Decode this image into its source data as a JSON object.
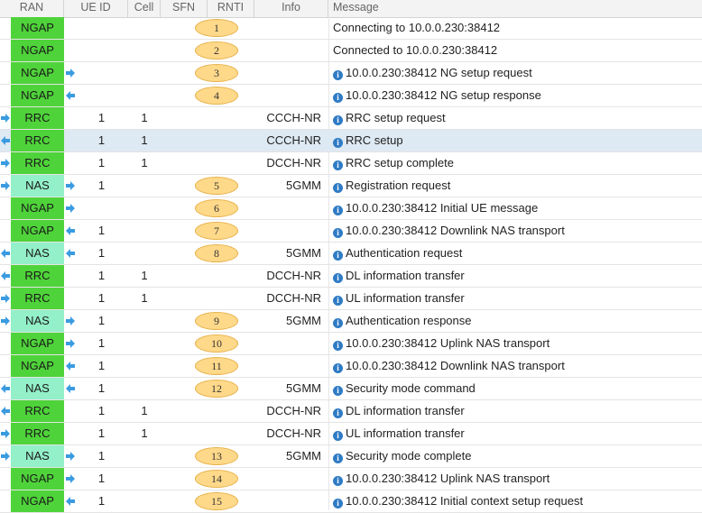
{
  "columns": [
    "RAN",
    "UE ID",
    "Cell",
    "SFN",
    "RNTI",
    "Info",
    "Message"
  ],
  "icons": {
    "right": "arrow-right-icon",
    "left": "arrow-left-icon",
    "info": "info-icon"
  },
  "colors": {
    "ngap": "#4fd33a",
    "nas": "#93f0c8",
    "badge": "#ffd98a",
    "arrow": "#3a9be0",
    "selected_row": "#dde9f3"
  },
  "rows": [
    {
      "ran": "NGAP",
      "ue": "",
      "cell": "",
      "badge": "1",
      "info": "",
      "message": "Connecting to 10.0.0.230:38412",
      "info_icon": false,
      "right_arrow": false,
      "left_arrow": false
    },
    {
      "ran": "NGAP",
      "ue": "",
      "cell": "",
      "badge": "2",
      "info": "",
      "message": "Connected to 10.0.0.230:38412",
      "info_icon": false,
      "right_arrow": false,
      "left_arrow": false
    },
    {
      "ran": "NGAP",
      "ue": "",
      "cell": "",
      "badge": "3",
      "info": "",
      "message": "10.0.0.230:38412 NG setup request",
      "info_icon": true,
      "right_arrow": true,
      "left_arrow": false
    },
    {
      "ran": "NGAP",
      "ue": "",
      "cell": "",
      "badge": "4",
      "info": "",
      "message": "10.0.0.230:38412 NG setup response",
      "info_icon": true,
      "right_arrow": false,
      "left_arrow": true
    },
    {
      "ran": "RRC",
      "ue": "1",
      "cell": "1",
      "badge": "",
      "info": "CCCH-NR",
      "message": "RRC setup request",
      "info_icon": true,
      "right_arrow": false,
      "left_arrow": false,
      "pre_arrow": "right"
    },
    {
      "ran": "RRC",
      "ue": "1",
      "cell": "1",
      "badge": "",
      "info": "CCCH-NR",
      "message": "RRC setup",
      "info_icon": true,
      "right_arrow": false,
      "left_arrow": false,
      "pre_arrow": "left",
      "selected": true
    },
    {
      "ran": "RRC",
      "ue": "1",
      "cell": "1",
      "badge": "",
      "info": "DCCH-NR",
      "message": "RRC setup complete",
      "info_icon": true,
      "right_arrow": false,
      "left_arrow": false,
      "pre_arrow": "right"
    },
    {
      "ran": "NAS",
      "ue": "1",
      "cell": "",
      "badge": "5",
      "info": "5GMM",
      "message": "Registration request",
      "info_icon": true,
      "right_arrow": true,
      "left_arrow": false,
      "pre_arrow": "right"
    },
    {
      "ran": "NGAP",
      "ue": "",
      "cell": "",
      "badge": "6",
      "info": "",
      "message": "10.0.0.230:38412 Initial UE message",
      "info_icon": true,
      "right_arrow": true,
      "left_arrow": false
    },
    {
      "ran": "NGAP",
      "ue": "1",
      "cell": "",
      "badge": "7",
      "info": "",
      "message": "10.0.0.230:38412 Downlink NAS transport",
      "info_icon": true,
      "right_arrow": false,
      "left_arrow": true
    },
    {
      "ran": "NAS",
      "ue": "1",
      "cell": "",
      "badge": "8",
      "info": "5GMM",
      "message": "Authentication request",
      "info_icon": true,
      "right_arrow": false,
      "left_arrow": true,
      "pre_arrow": "left"
    },
    {
      "ran": "RRC",
      "ue": "1",
      "cell": "1",
      "badge": "",
      "info": "DCCH-NR",
      "message": "DL information transfer",
      "info_icon": true,
      "right_arrow": false,
      "left_arrow": false,
      "pre_arrow": "left"
    },
    {
      "ran": "RRC",
      "ue": "1",
      "cell": "1",
      "badge": "",
      "info": "DCCH-NR",
      "message": "UL information transfer",
      "info_icon": true,
      "right_arrow": false,
      "left_arrow": false,
      "pre_arrow": "right"
    },
    {
      "ran": "NAS",
      "ue": "1",
      "cell": "",
      "badge": "9",
      "info": "5GMM",
      "message": "Authentication response",
      "info_icon": true,
      "right_arrow": true,
      "left_arrow": false,
      "pre_arrow": "right"
    },
    {
      "ran": "NGAP",
      "ue": "1",
      "cell": "",
      "badge": "10",
      "info": "",
      "message": "10.0.0.230:38412 Uplink NAS transport",
      "info_icon": true,
      "right_arrow": true,
      "left_arrow": false
    },
    {
      "ran": "NGAP",
      "ue": "1",
      "cell": "",
      "badge": "11",
      "info": "",
      "message": "10.0.0.230:38412 Downlink NAS transport",
      "info_icon": true,
      "right_arrow": false,
      "left_arrow": true
    },
    {
      "ran": "NAS",
      "ue": "1",
      "cell": "",
      "badge": "12",
      "info": "5GMM",
      "message": "Security mode command",
      "info_icon": true,
      "right_arrow": false,
      "left_arrow": true,
      "pre_arrow": "left"
    },
    {
      "ran": "RRC",
      "ue": "1",
      "cell": "1",
      "badge": "",
      "info": "DCCH-NR",
      "message": "DL information transfer",
      "info_icon": true,
      "right_arrow": false,
      "left_arrow": false,
      "pre_arrow": "left"
    },
    {
      "ran": "RRC",
      "ue": "1",
      "cell": "1",
      "badge": "",
      "info": "DCCH-NR",
      "message": "UL information transfer",
      "info_icon": true,
      "right_arrow": false,
      "left_arrow": false,
      "pre_arrow": "right"
    },
    {
      "ran": "NAS",
      "ue": "1",
      "cell": "",
      "badge": "13",
      "info": "5GMM",
      "message": "Security mode complete",
      "info_icon": true,
      "right_arrow": true,
      "left_arrow": false,
      "pre_arrow": "right"
    },
    {
      "ran": "NGAP",
      "ue": "1",
      "cell": "",
      "badge": "14",
      "info": "",
      "message": "10.0.0.230:38412 Uplink NAS transport",
      "info_icon": true,
      "right_arrow": true,
      "left_arrow": false
    },
    {
      "ran": "NGAP",
      "ue": "1",
      "cell": "",
      "badge": "15",
      "info": "",
      "message": "10.0.0.230:38412 Initial context setup request",
      "info_icon": true,
      "right_arrow": false,
      "left_arrow": true
    }
  ]
}
